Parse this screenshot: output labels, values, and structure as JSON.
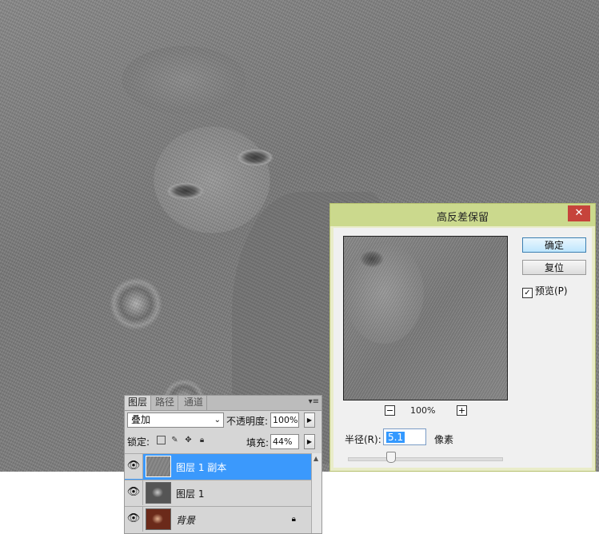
{
  "dialog": {
    "title": "高反差保留",
    "close_glyph": "✕",
    "ok_label": "确定",
    "reset_label": "复位",
    "preview_checkbox": {
      "label": "预览(P)",
      "checked": true
    },
    "zoom_out_glyph": "−",
    "zoom_in_glyph": "+",
    "zoom_level": "100%",
    "radius_label": "半径(R):",
    "radius_value": "5.1",
    "radius_unit": "像素"
  },
  "layers_panel": {
    "tabs": [
      "图层",
      "路径",
      "通道"
    ],
    "menu_glyph": "▾≡",
    "blend_mode": "叠加",
    "opacity_label": "不透明度:",
    "opacity_value": "100%",
    "lock_label": "锁定:",
    "fill_label": "填充:",
    "fill_value": "44%",
    "layers": [
      {
        "name": "图层 1 副本",
        "visible": true,
        "selected": true
      },
      {
        "name": "图层 1",
        "visible": true,
        "selected": false
      },
      {
        "name": "背景",
        "visible": true,
        "selected": false,
        "locked": true
      }
    ]
  },
  "icons": {
    "eye": "eye-icon",
    "lock": "lock-icon",
    "checkbox_check": "✓"
  },
  "colors": {
    "dialog_titlebar": "#cbd98d",
    "close_button": "#c6433b",
    "selected_layer": "#3b99fc",
    "selection_highlight": "#3399ff"
  }
}
